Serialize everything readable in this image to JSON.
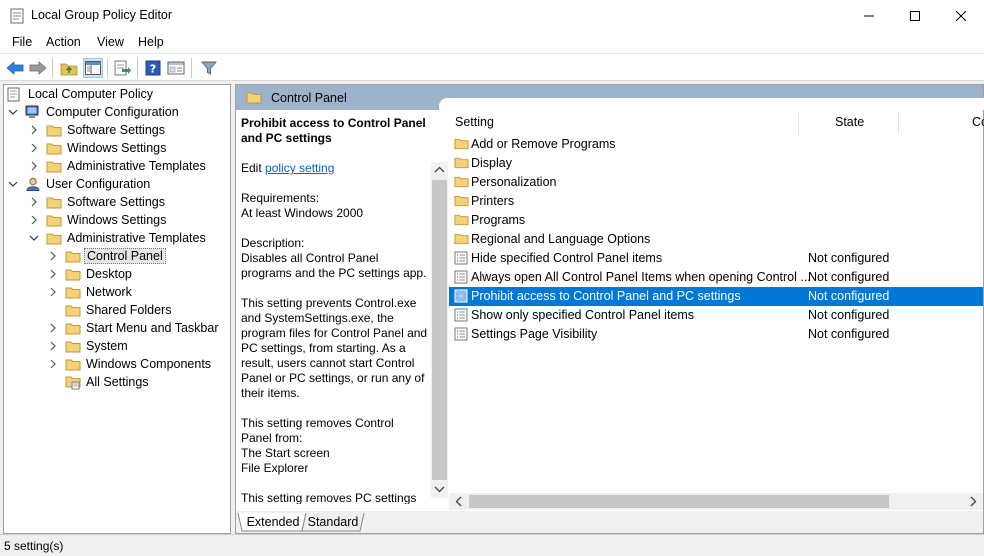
{
  "window": {
    "title": "Local Group Policy Editor"
  },
  "menu": [
    "File",
    "Action",
    "View",
    "Help"
  ],
  "toolbar": {
    "icons": [
      "back-arrow-icon",
      "forward-arrow-icon",
      "up-folder-icon",
      "show-hide-tree-icon",
      "export-list-icon",
      "help-icon",
      "properties-view-icon",
      "filter-icon"
    ]
  },
  "tree": {
    "root": "Local Computer Policy",
    "computer_config": "Computer Configuration",
    "cc_software": "Software Settings",
    "cc_windows": "Windows Settings",
    "cc_admin": "Administrative Templates",
    "user_config": "User Configuration",
    "uc_software": "Software Settings",
    "uc_windows": "Windows Settings",
    "uc_admin": "Administrative Templates",
    "control_panel": "Control Panel",
    "desktop": "Desktop",
    "network": "Network",
    "shared_folders": "Shared Folders",
    "start_menu": "Start Menu and Taskbar",
    "system": "System",
    "windows_components": "Windows Components",
    "all_settings": "All Settings"
  },
  "pane": {
    "header": "Control Panel",
    "description": {
      "title": "Prohibit access to Control Panel and PC settings",
      "edit_prefix": "Edit ",
      "edit_link": "policy setting ",
      "req_label": "Requirements:",
      "req_value": "At least Windows 2000",
      "desc_label": "Description:",
      "desc_text": "Disables all Control Panel programs and the PC settings app.",
      "para1": "This setting prevents Control.exe and SystemSettings.exe, the program files for Control Panel and PC settings, from starting. As a result, users cannot start Control Panel or PC settings, or run any of their items.",
      "para2_l1": "This setting removes Control",
      "para2_l2": "Panel from:",
      "para2_l3": "The Start screen",
      "para2_l4": "File Explorer",
      "para3": "This setting removes PC settings"
    },
    "columns": {
      "setting": "Setting",
      "state": "State",
      "comment": "Co"
    },
    "rows": [
      {
        "name": "Add or Remove Programs",
        "state": "",
        "type": "folder"
      },
      {
        "name": "Display",
        "state": "",
        "type": "folder"
      },
      {
        "name": "Personalization",
        "state": "",
        "type": "folder"
      },
      {
        "name": "Printers",
        "state": "",
        "type": "folder"
      },
      {
        "name": "Programs",
        "state": "",
        "type": "folder"
      },
      {
        "name": "Regional and Language Options",
        "state": "",
        "type": "folder"
      },
      {
        "name": "Hide specified Control Panel items",
        "state": "Not configured",
        "type": "policy"
      },
      {
        "name": "Always open All Control Panel Items when opening Control ...",
        "state": "Not configured",
        "type": "policy"
      },
      {
        "name": "Prohibit access to Control Panel and PC settings",
        "state": "Not configured",
        "type": "policy",
        "selected": true
      },
      {
        "name": "Show only specified Control Panel items",
        "state": "Not configured",
        "type": "policy"
      },
      {
        "name": "Settings Page Visibility",
        "state": "Not configured",
        "type": "policy"
      }
    ],
    "tabs": {
      "extended": "Extended",
      "standard": "Standard"
    }
  },
  "status": {
    "text": "5 setting(s)"
  },
  "colors": {
    "selection": "#0078d7",
    "header_band": "#9db3cb",
    "folder": "#e8c05a",
    "link": "#0066cc"
  }
}
